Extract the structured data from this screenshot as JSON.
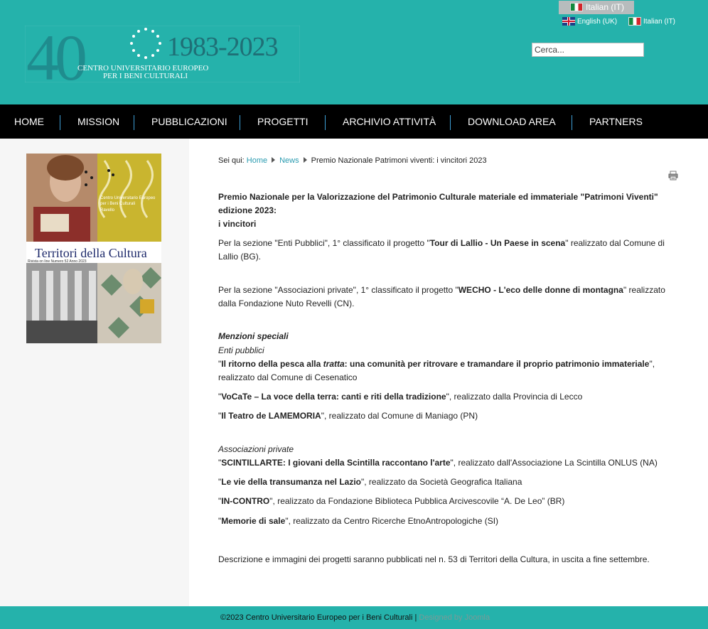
{
  "header": {
    "logo": {
      "number": "40",
      "years": "1983-2023",
      "org_line1": "CENTRO UNIVERSITARIO EUROPEO",
      "org_line2": "PER I BENI CULTURALI"
    },
    "lang_active": "Italian (IT)",
    "lang_links": [
      "English (UK)",
      "Italian (IT)"
    ],
    "search_placeholder": "Cerca..."
  },
  "nav": [
    "HOME",
    "MISSION",
    "PUBBLICAZIONI",
    "PROGETTI",
    "ARCHIVIO ATTIVITÀ",
    "DOWNLOAD AREA",
    "PARTNERS"
  ],
  "sidebar": {
    "cover_title": "Territori della Cultura",
    "cover_subtitle": "Rivista on line Numero 52 Anno 2023",
    "cover_badge_line1": "Centro Universitario Europeo",
    "cover_badge_line2": "per i Beni Culturali",
    "cover_badge_line3": "Ravello"
  },
  "breadcrumb": {
    "prefix": "Sei qui:",
    "home": "Home",
    "news": "News",
    "current": "Premio Nazionale Patrimoni viventi: i vincitori 2023"
  },
  "content": {
    "title_line1": "Premio Nazionale per la Valorizzazione del Patrimonio Culturale materiale ed immateriale \"Patrimoni Viventi\" edizione 2023:",
    "title_line2": "i vincitori",
    "p1_a": "Per la sezione \"Enti Pubblici\", 1° classificato il progetto \"",
    "p1_b": "Tour di Lallio  - Un Paese in scena",
    "p1_c": "\" realizzato dal Comune di Lallio (BG).",
    "p2_a": "Per la sezione \"Associazioni private\", 1° classificato il progetto \"",
    "p2_b": "WECHO - L'eco delle donne di montagna",
    "p2_c": "\"  realizzato dalla Fondazione Nuto Revelli (CN).",
    "menzioni": "Menzioni speciali",
    "enti_pubblici": "Enti pubblici",
    "e1_a": "\"",
    "e1_b": "Il ritorno della pesca alla ",
    "e1_i": "tratta",
    "e1_c": ": una comunità per ritrovare e tramandare il proprio patrimonio immateriale",
    "e1_d": "\", realizzato dal Comune di Cesenatico",
    "e2_a": "\"",
    "e2_b": "VoCaTe – La voce della terra: canti e riti della tradizione",
    "e2_c": "\", realizzato dalla Provincia di Lecco",
    "e3_a": "\"",
    "e3_b": "Il Teatro de LAMEMORIA",
    "e3_c": "\", realizzato dal Comune di Maniago (PN)",
    "assoc_private": "Associazioni private",
    "a1_a": "\"",
    "a1_b": "SCINTILLARTE: I giovani della Scintilla raccontano l'arte",
    "a1_c": "\",  realizzato dall'Associazione La Scintilla ONLUS (NA)",
    "a2_a": "\"",
    "a2_b": "Le vie della transumanza nel Lazio",
    "a2_c": "\", realizzato da Società Geografica Italiana",
    "a3_a": "\"",
    "a3_b": "IN-CONTRO",
    "a3_c": "\", realizzato da Fondazione Biblioteca Pubblica Arcivescovile “A. De Leo” (BR)",
    "a4_a": "\"",
    "a4_b": "Memorie di sale",
    "a4_c": "\", realizzato da Centro Ricerche EtnoAntropologiche (SI)",
    "closing": "Descrizione e immagini dei progetti saranno pubblicati nel n. 53 di Territori della Cultura, in uscita a fine settembre."
  },
  "footer": {
    "copyright": "©2023 Centro Universitario Europeo per i Beni Culturali | ",
    "designed": "Designed by Joomla"
  }
}
